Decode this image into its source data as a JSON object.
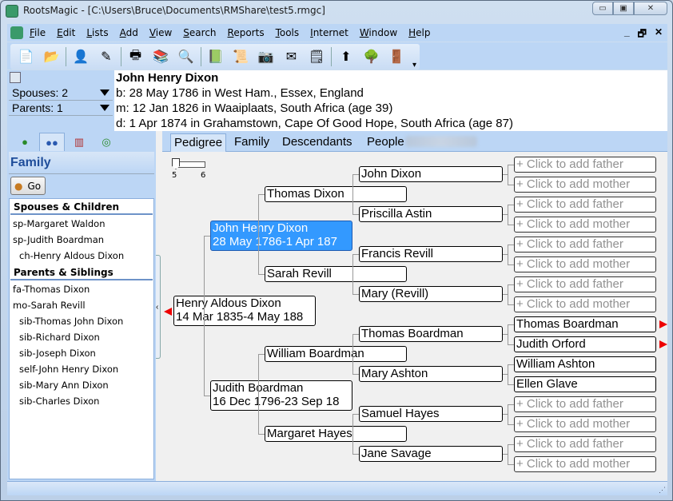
{
  "window": {
    "title": "RootsMagic - [C:\\Users\\Bruce\\Documents\\RMShare\\test5.rmgc]",
    "controls": {
      "minimize": "▭",
      "maximize": "▣",
      "close": "✕"
    }
  },
  "menu": {
    "items": [
      {
        "u": "F",
        "rest": "ile"
      },
      {
        "u": "E",
        "rest": "dit"
      },
      {
        "u": "L",
        "rest": "ists"
      },
      {
        "u": "A",
        "rest": "dd"
      },
      {
        "u": "V",
        "rest": "iew"
      },
      {
        "u": "S",
        "rest": "earch"
      },
      {
        "u": "R",
        "rest": "eports"
      },
      {
        "u": "T",
        "rest": "ools"
      },
      {
        "u": "I",
        "rest": "nternet"
      },
      {
        "u": "W",
        "rest": "indow"
      },
      {
        "u": "H",
        "rest": "elp"
      }
    ],
    "mdi": {
      "minimize": "_",
      "restore": "🗗",
      "close": "✕"
    }
  },
  "toolbar": {
    "icons": [
      "new-file-icon",
      "open-file-icon",
      "add-person-icon",
      "edit-person-icon",
      "print-icon",
      "books-icon",
      "search-icon",
      "publish-icon",
      "certificate-icon",
      "camera-icon",
      "card-icon",
      "note-icon",
      "merge-sign-icon",
      "tree-icon",
      "exit-door-icon"
    ],
    "glyphs": [
      "📄",
      "📂",
      "👤",
      "✎",
      "🖶",
      "📚",
      "🔍",
      "📗",
      "📜",
      "📷",
      "✉",
      "🗒",
      "⬆",
      "🌳",
      "🚪"
    ],
    "overflow": "▾"
  },
  "header": {
    "spouses": "Spouses: 2",
    "parents": "Parents: 1",
    "person_name": "John Henry Dixon",
    "birth": "b: 28 May 1786 in West Ham., Essex, England",
    "marriage": "m: 12 Jan 1826 in Waaiplaats, South Africa (age 39)",
    "death": "d: 1 Apr 1874 in Grahamstown, Cape Of Good Hope, South Africa (age 87)"
  },
  "left_panel": {
    "tabs": [
      "person-tab",
      "family-tab",
      "book-tab",
      "web-tab"
    ],
    "title": "Family",
    "go_label": "Go",
    "sections": [
      {
        "title": "Spouses & Children",
        "items": [
          {
            "label": "sp-Margaret Waldon",
            "indent": false
          },
          {
            "label": "sp-Judith Boardman",
            "indent": false
          },
          {
            "label": "ch-Henry Aldous Dixon",
            "indent": true
          }
        ]
      },
      {
        "title": "Parents & Siblings",
        "items": [
          {
            "label": "fa-Thomas Dixon",
            "indent": false
          },
          {
            "label": "mo-Sarah Revill",
            "indent": false
          },
          {
            "label": "sib-Thomas John Dixon",
            "indent": true
          },
          {
            "label": "sib-Richard Dixon",
            "indent": true
          },
          {
            "label": "sib-Joseph Dixon",
            "indent": true
          },
          {
            "label": "self-John Henry Dixon",
            "indent": true
          },
          {
            "label": "sib-Mary Ann Dixon",
            "indent": true
          },
          {
            "label": "sib-Charles Dixon",
            "indent": true
          }
        ]
      }
    ]
  },
  "view_tabs": {
    "items": [
      "Pedigree",
      "Family",
      "Descendants",
      "People"
    ],
    "active": "Pedigree"
  },
  "pedigree": {
    "generations_slider": {
      "min": "5",
      "max": "6",
      "value": 5
    },
    "gen1": {
      "name": "Henry Aldous Dixon",
      "dates": "14 Mar 1835-4 May 188"
    },
    "gen2": [
      {
        "name": "John Henry Dixon",
        "dates": "28 May 1786-1 Apr 187",
        "selected": true
      },
      {
        "name": "Judith Boardman",
        "dates": "16 Dec 1796-23 Sep 18",
        "selected": false
      }
    ],
    "gen3": [
      "Thomas Dixon",
      "Sarah Revill",
      "William Boardman",
      "Margaret Hayes"
    ],
    "gen4": [
      "John Dixon",
      "Priscilla Astin",
      "Francis Revill",
      "Mary (Revill)",
      "Thomas Boardman",
      "Mary Ashton",
      "Samuel Hayes",
      "Jane Savage"
    ],
    "gen5": [
      {
        "name": "+ Click to add father",
        "placeholder": true,
        "more": false
      },
      {
        "name": "+ Click to add mother",
        "placeholder": true,
        "more": false
      },
      {
        "name": "+ Click to add father",
        "placeholder": true,
        "more": false
      },
      {
        "name": "+ Click to add mother",
        "placeholder": true,
        "more": false
      },
      {
        "name": "+ Click to add father",
        "placeholder": true,
        "more": false
      },
      {
        "name": "+ Click to add mother",
        "placeholder": true,
        "more": false
      },
      {
        "name": "+ Click to add father",
        "placeholder": true,
        "more": false
      },
      {
        "name": "+ Click to add mother",
        "placeholder": true,
        "more": false
      },
      {
        "name": "Thomas Boardman",
        "placeholder": false,
        "more": true
      },
      {
        "name": "Judith Orford",
        "placeholder": false,
        "more": true
      },
      {
        "name": "William Ashton",
        "placeholder": false,
        "more": false
      },
      {
        "name": "Ellen Glave",
        "placeholder": false,
        "more": false
      },
      {
        "name": "+ Click to add father",
        "placeholder": true,
        "more": false
      },
      {
        "name": "+ Click to add mother",
        "placeholder": true,
        "more": false
      },
      {
        "name": "+ Click to add father",
        "placeholder": true,
        "more": false
      },
      {
        "name": "+ Click to add mother",
        "placeholder": true,
        "more": false
      }
    ]
  },
  "colors": {
    "selected_box": "#3399ff",
    "panel_blue": "#bcd6f5",
    "more_arrow": "#ee0000",
    "placeholder_text": "#909090"
  }
}
